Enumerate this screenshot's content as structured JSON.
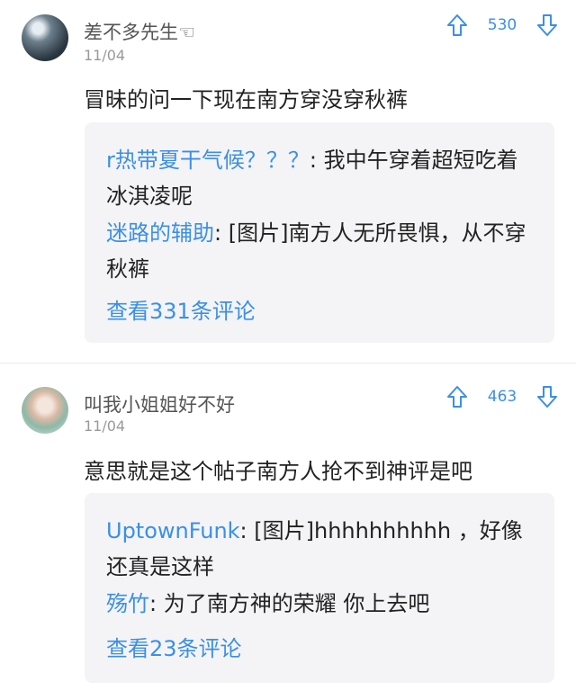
{
  "accent_color": "#3b8fe6",
  "posts": [
    {
      "username": "差不多先生☜",
      "date": "11/04",
      "upvotes": "530",
      "content": "冒昧的问一下现在南方穿没穿秋裤",
      "replies": [
        {
          "author": "r热带夏干气候？？？",
          "text": ": 我中午穿着超短吃着冰淇凌呢"
        },
        {
          "author": "迷路的辅助",
          "text": ": [图片]南方人无所畏惧，从不穿秋裤"
        }
      ],
      "more_comments": "查看331条评论"
    },
    {
      "username": "叫我小姐姐好不好",
      "date": "11/04",
      "upvotes": "463",
      "content": "意思就是这个帖子南方人抢不到神评是吧",
      "replies": [
        {
          "author": "UptownFunk",
          "text": ": [图片]hhhhhhhhhh ，好像还真是这样"
        },
        {
          "author": "殇竹",
          "text": ": 为了南方神的荣耀  你上去吧"
        }
      ],
      "more_comments": "查看23条评论"
    }
  ]
}
